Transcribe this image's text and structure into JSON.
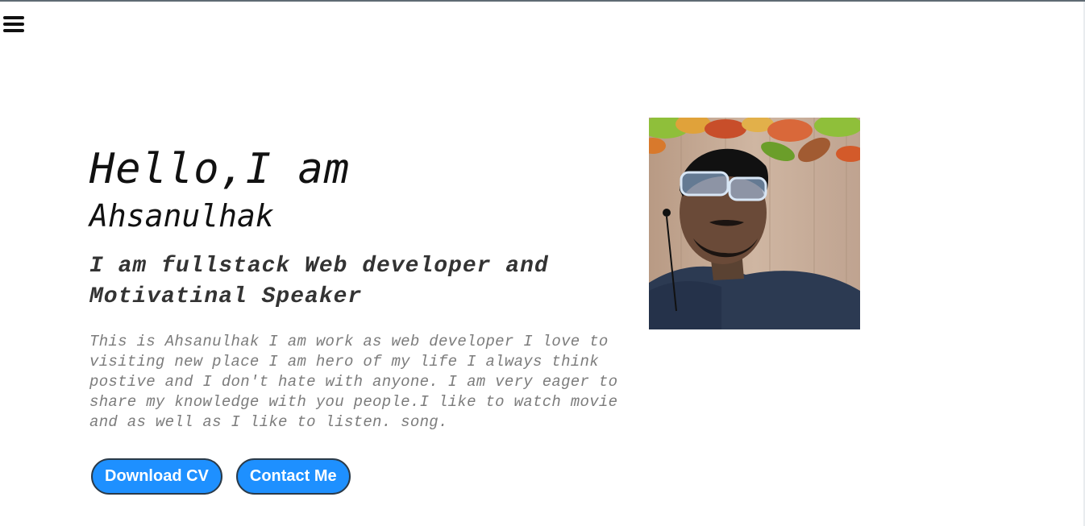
{
  "nav": {
    "menu_icon": "hamburger-menu-icon"
  },
  "hero": {
    "greeting": "Hello,I am",
    "name": "Ahsanulhak",
    "tagline_line1": "I am fullstack Web developer and",
    "tagline_line2": "Motivatinal Speaker",
    "bio": "This is Ahsanulhak I am work as web developer I love to visiting new place I am hero of my life I always think postive and I don't hate with anyone. I am very eager to share my knowledge with you people.I like to watch movie and as well as I like to listen. song.",
    "buttons": {
      "download_label": "Download CV",
      "contact_label": "Contact Me"
    }
  },
  "colors": {
    "button_bg": "#1e90ff",
    "button_border": "#2b3a48",
    "text_primary": "#111111",
    "text_muted": "#7c7c7c"
  }
}
